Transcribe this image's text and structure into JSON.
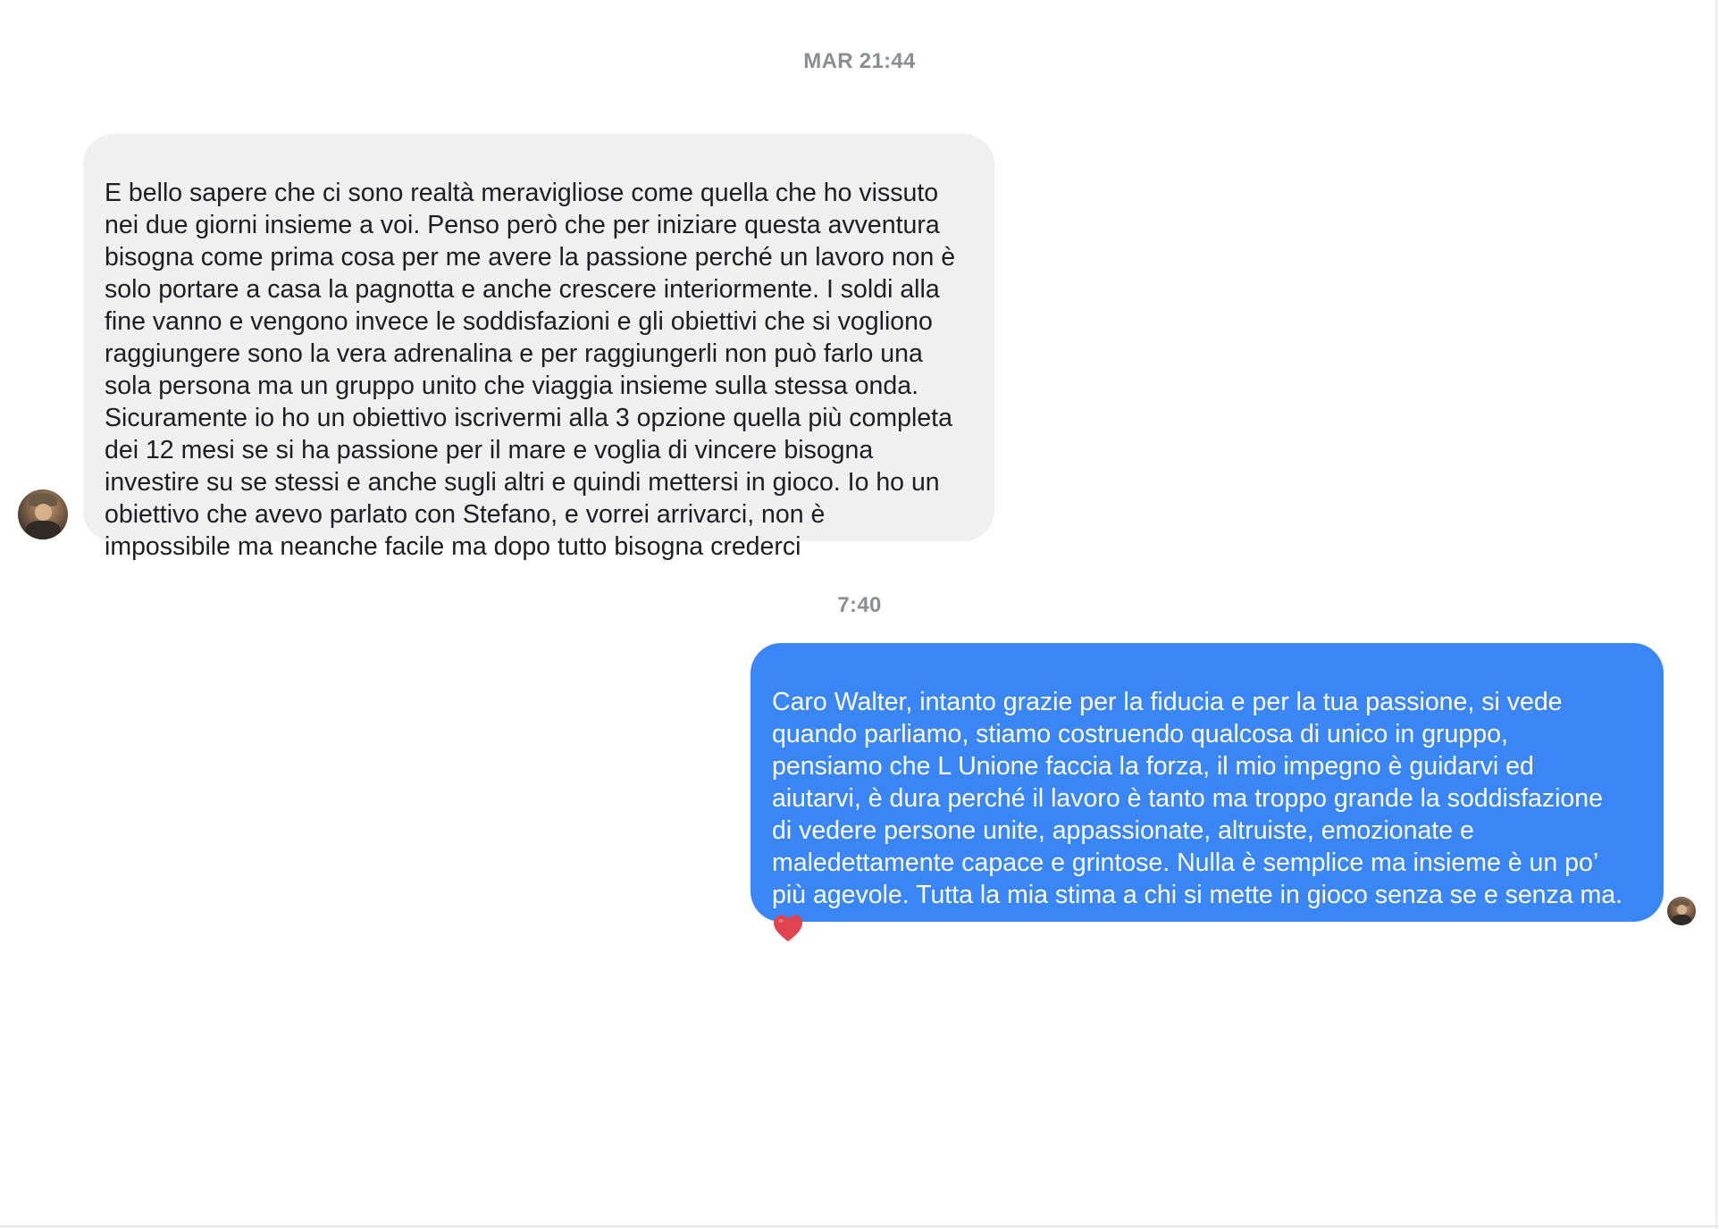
{
  "conversation": {
    "timestamps": [
      "MAR 21:44",
      "7:40"
    ],
    "messages": [
      {
        "direction": "incoming",
        "text": "E bello sapere che ci sono realtà meravigliose  come quella che ho vissuto\nnei due giorni insieme a voi. Penso però che per iniziare questa avventura\nbisogna come prima cosa per me avere la passione perché un lavoro non è\nsolo portare a casa la pagnotta e anche crescere interiormente. I soldi alla\nfine vanno e vengono invece le soddisfazioni e gli obiettivi che si vogliono\nraggiungere sono la vera adrenalina e per raggiungerli non può farlo una\nsola persona ma un gruppo unito che viaggia insieme sulla stessa onda.\nSicuramente io ho un obiettivo iscrivermi alla 3 opzione quella più completa\ndei 12 mesi se si ha passione per il mare e voglia di vincere bisogna\ninvestire su se stessi e anche sugli altri e quindi mettersi in gioco. Io ho un\nobiettivo che avevo parlato con Stefano, e vorrei arrivarci, non è\nimpossibile ma neanche facile ma dopo tutto bisogna crederci",
        "bubble_color": "#f1f0f0"
      },
      {
        "direction": "outgoing",
        "text": "Caro Walter, intanto grazie per la fiducia e per la tua passione, si vede\nquando parliamo, stiamo costruendo qualcosa di unico in gruppo,\npensiamo che L Unione faccia la forza, il mio impegno è guidarvi  ed\naiutarvi, è dura perché il lavoro è tanto ma troppo grande la soddisfazione\ndi vedere persone unite, appassionate, altruiste, emozionate  e\nmaledettamente capace e grintose.  Nulla è semplice ma insieme è un po’\npiù agevole. Tutta la mia stima a chi si mette in gioco senza se e senza ma.",
        "emoji": "heart-icon",
        "bubble_color": "#3b86f7"
      }
    ]
  },
  "colors": {
    "timestamp": "#8b8e93",
    "incoming_text": "#1c1e21",
    "outgoing_text": "#ffffff",
    "heart": "#e0454f"
  },
  "icons": {
    "incoming_avatar": "user-avatar-icon",
    "outgoing_avatar": "user-avatar-small-icon",
    "reaction": "heart-icon"
  }
}
